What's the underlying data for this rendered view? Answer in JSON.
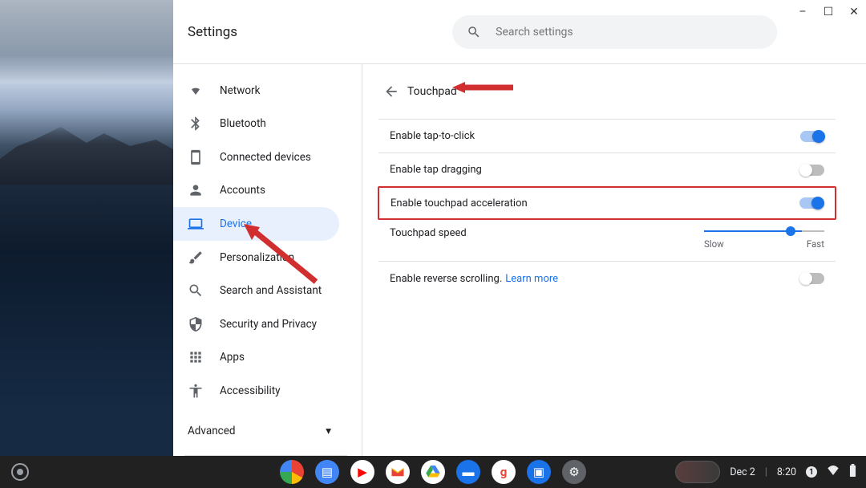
{
  "header": {
    "title": "Settings"
  },
  "search": {
    "placeholder": "Search settings"
  },
  "sidebar": {
    "items": [
      {
        "label": "Network"
      },
      {
        "label": "Bluetooth"
      },
      {
        "label": "Connected devices"
      },
      {
        "label": "Accounts"
      },
      {
        "label": "Device"
      },
      {
        "label": "Personalization"
      },
      {
        "label": "Search and Assistant"
      },
      {
        "label": "Security and Privacy"
      },
      {
        "label": "Apps"
      },
      {
        "label": "Accessibility"
      }
    ],
    "advanced_label": "Advanced"
  },
  "content": {
    "page_title": "Touchpad",
    "rows": {
      "tap_click": {
        "label": "Enable tap-to-click",
        "state": "on"
      },
      "tap_drag": {
        "label": "Enable tap dragging",
        "state": "off"
      },
      "accel": {
        "label": "Enable touchpad acceleration",
        "state": "on"
      },
      "speed": {
        "label": "Touchpad speed",
        "min_label": "Slow",
        "max_label": "Fast"
      },
      "reverse": {
        "label": "Enable reverse scrolling.",
        "learn_more": "Learn more",
        "state": "off"
      }
    }
  },
  "shelf": {
    "date": "Dec 2",
    "time": "8:20",
    "apps": [
      "chrome",
      "docs",
      "youtube",
      "gmail",
      "drive",
      "messages",
      "google",
      "files",
      "settings"
    ]
  },
  "colors": {
    "accent": "#1a73e8",
    "highlight": "#d12f2f"
  }
}
